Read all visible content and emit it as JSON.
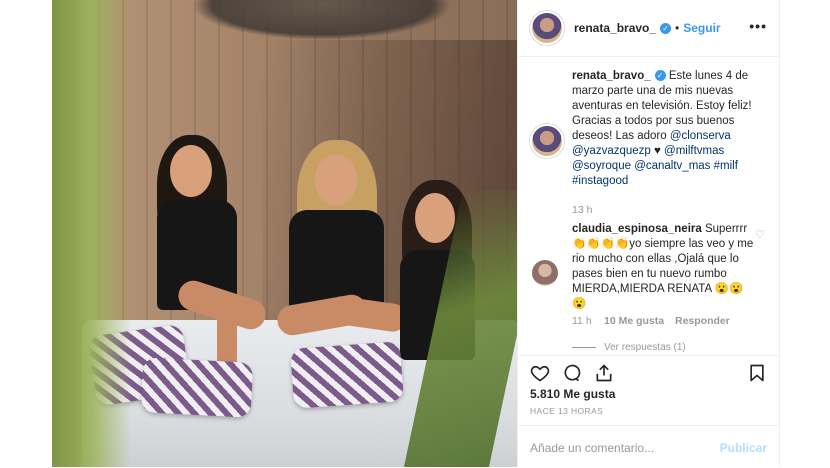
{
  "post": {
    "username": "renata_bravo_",
    "separator": "•",
    "follow_label": "Seguir",
    "more_label": "•••"
  },
  "caption": {
    "username": "renata_bravo_",
    "text_1": "Este lunes 4 de marzo parte una de mis nuevas aventuras en televisión. Estoy feliz! Gracias a todos por sus buenos deseos! Las adoro",
    "mention_1": "@clonserva",
    "mention_2": "@yazvazquezp",
    "heart": "♥",
    "mention_3": "@milftvmas",
    "mention_4": "@soyroque",
    "mention_5": "@canaltv_mas",
    "hashtag_1": "#milf",
    "hashtag_2": "#instagood",
    "time": "13 h"
  },
  "comment": {
    "username": "claudia_espinosa_neira",
    "text": "Superrrr 👏👏👏👏yo siempre las veo y me rio mucho con ellas ,Ojalá que lo pases bien en tu nuevo rumbo MIERDA,MIERDA RENATA 😮😮😮",
    "time": "11 h",
    "likes": "10 Me gusta",
    "reply": "Responder",
    "view_replies": "Ver respuestas (1)"
  },
  "stats": {
    "likes": "5.810 Me gusta",
    "ago": "HACE 13 HORAS"
  },
  "comment_box": {
    "placeholder": "Añade un comentario...",
    "publish": "Publicar"
  },
  "icons": {
    "verified": "✓",
    "heart_small": "♡"
  },
  "colors": {
    "link_blue": "#3897f0",
    "mention_blue": "#003569",
    "muted": "#999999",
    "publish_disabled": "#b2dffc"
  }
}
